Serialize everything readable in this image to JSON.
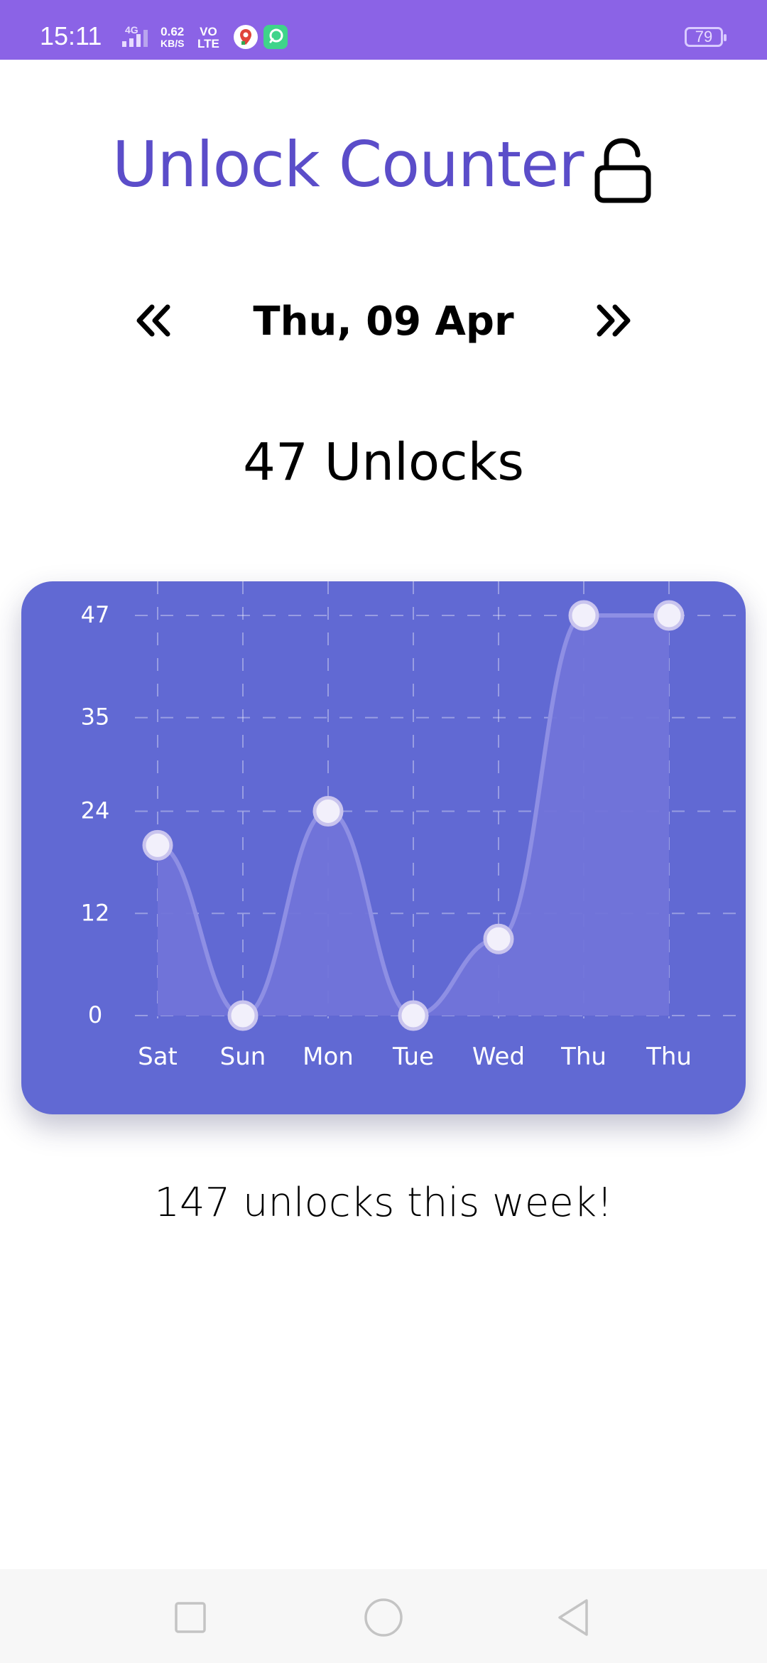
{
  "status_bar": {
    "time": "15:11",
    "network": "4G",
    "speed_value": "0.62",
    "speed_unit": "KB/S",
    "volte_top": "VO",
    "volte_bottom": "LTE",
    "battery": "79",
    "bg_color": "#8B63E6"
  },
  "header": {
    "title": "Unlock Counter",
    "title_color": "#5B4DC9",
    "icon": "lock-open-icon"
  },
  "date_nav": {
    "prev_icon": "double-chevron-left-icon",
    "date": "Thu, 09 Apr",
    "next_icon": "double-chevron-right-icon"
  },
  "today": {
    "count_text": "47 Unlocks"
  },
  "chart_data": {
    "type": "line",
    "categories": [
      "Sat",
      "Sun",
      "Mon",
      "Tue",
      "Wed",
      "Thu",
      "Thu"
    ],
    "values": [
      20,
      0,
      24,
      0,
      9,
      47,
      47
    ],
    "yticks": [
      0,
      12,
      24,
      35,
      47
    ],
    "ylim": [
      0,
      47
    ],
    "grid": true,
    "smooth": true,
    "filled": true,
    "background_color": "#6169D3",
    "line_color": "#8E8FE4",
    "fill_color": "#7174D9",
    "point_color": "#F2F0FB"
  },
  "summary": {
    "week_text": "147 unlocks this week!"
  },
  "system_nav": {
    "recents_icon": "square-icon",
    "home_icon": "circle-icon",
    "back_icon": "triangle-back-icon"
  }
}
